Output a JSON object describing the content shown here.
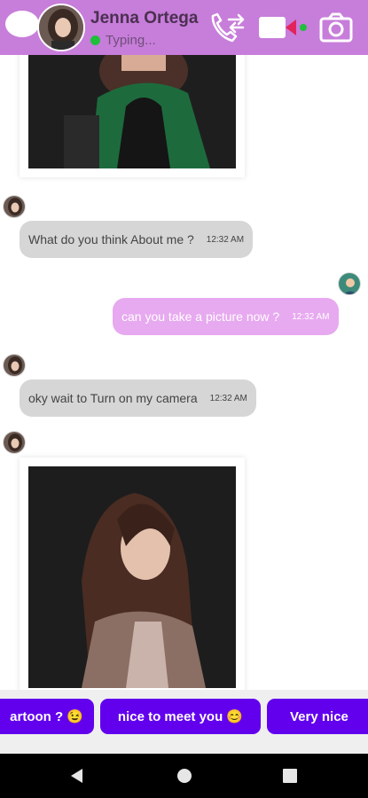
{
  "header": {
    "contact_name": "Jenna Ortega",
    "status": "Typing...",
    "icons": [
      "back-icon",
      "phone-transfer-icon",
      "video-call-icon",
      "camera-icon"
    ],
    "colors": {
      "bar": "#c77dda",
      "online": "#1fbf3a"
    }
  },
  "messages": [
    {
      "type": "image",
      "direction": "incoming",
      "description_icon": "photo"
    },
    {
      "type": "text",
      "direction": "incoming",
      "text": "What do you think About me ?",
      "time": "12:32 AM"
    },
    {
      "type": "text",
      "direction": "outgoing",
      "text": "can you take a picture now ?",
      "time": "12:32 AM"
    },
    {
      "type": "text",
      "direction": "incoming",
      "text": "oky wait to Turn on my camera",
      "time": "12:32 AM"
    },
    {
      "type": "image",
      "direction": "incoming",
      "description_icon": "photo"
    }
  ],
  "suggestions": [
    {
      "label": "artoon ? 😉"
    },
    {
      "label": "nice to meet you 😊"
    },
    {
      "label": "Very nice"
    }
  ],
  "colors": {
    "incoming_bubble": "#d6d6d6",
    "outgoing_bubble": "#e7a9f0",
    "chip": "#6200ee"
  },
  "navbar": {
    "icons": [
      "nav-back-icon",
      "nav-home-icon",
      "nav-recents-icon"
    ]
  }
}
